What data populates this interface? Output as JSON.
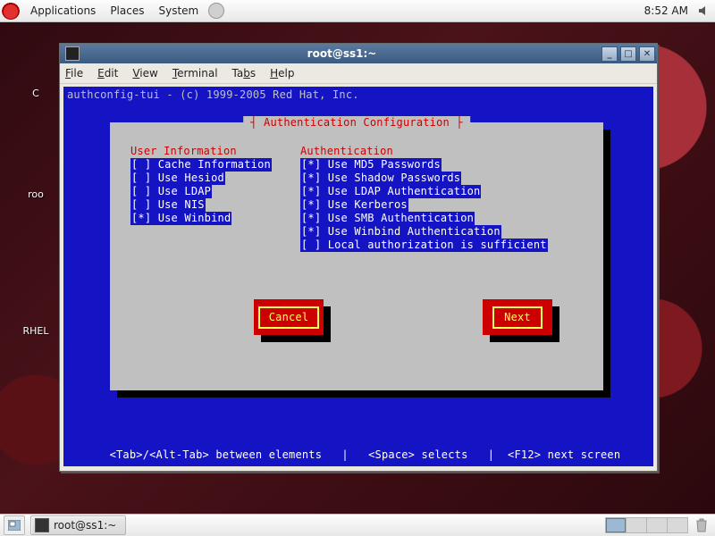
{
  "panel": {
    "menus": [
      "Applications",
      "Places",
      "System"
    ],
    "clock": "8:52 AM"
  },
  "desktop_icons": {
    "computer": "C",
    "home": "roo",
    "media": "RHEL"
  },
  "taskbar": {
    "task1": "root@ss1:~"
  },
  "window": {
    "title": "root@ss1:~",
    "menus": {
      "file": "File",
      "edit": "Edit",
      "view": "View",
      "terminal": "Terminal",
      "tabs": "Tabs",
      "help": "Help"
    }
  },
  "term": {
    "banner": "authconfig-tui - (c) 1999-2005 Red Hat, Inc.",
    "dialog_title": "Authentication Configuration",
    "left_head": "User Information",
    "right_head": "Authentication",
    "left_opts": [
      "[ ] Cache Information",
      "[ ] Use Hesiod",
      "[ ] Use LDAP",
      "[ ] Use NIS",
      "[*] Use Winbind"
    ],
    "right_opts": [
      "[*] Use MD5 Passwords",
      "[*] Use Shadow Passwords",
      "[*] Use LDAP Authentication",
      "[*] Use Kerberos",
      "[*] Use SMB Authentication",
      "[*] Use Winbind Authentication",
      "[ ] Local authorization is sufficient"
    ],
    "cancel": "Cancel",
    "next": "Next",
    "footer": "  <Tab>/<Alt-Tab> between elements   |   <Space> selects   |  <F12> next screen"
  }
}
